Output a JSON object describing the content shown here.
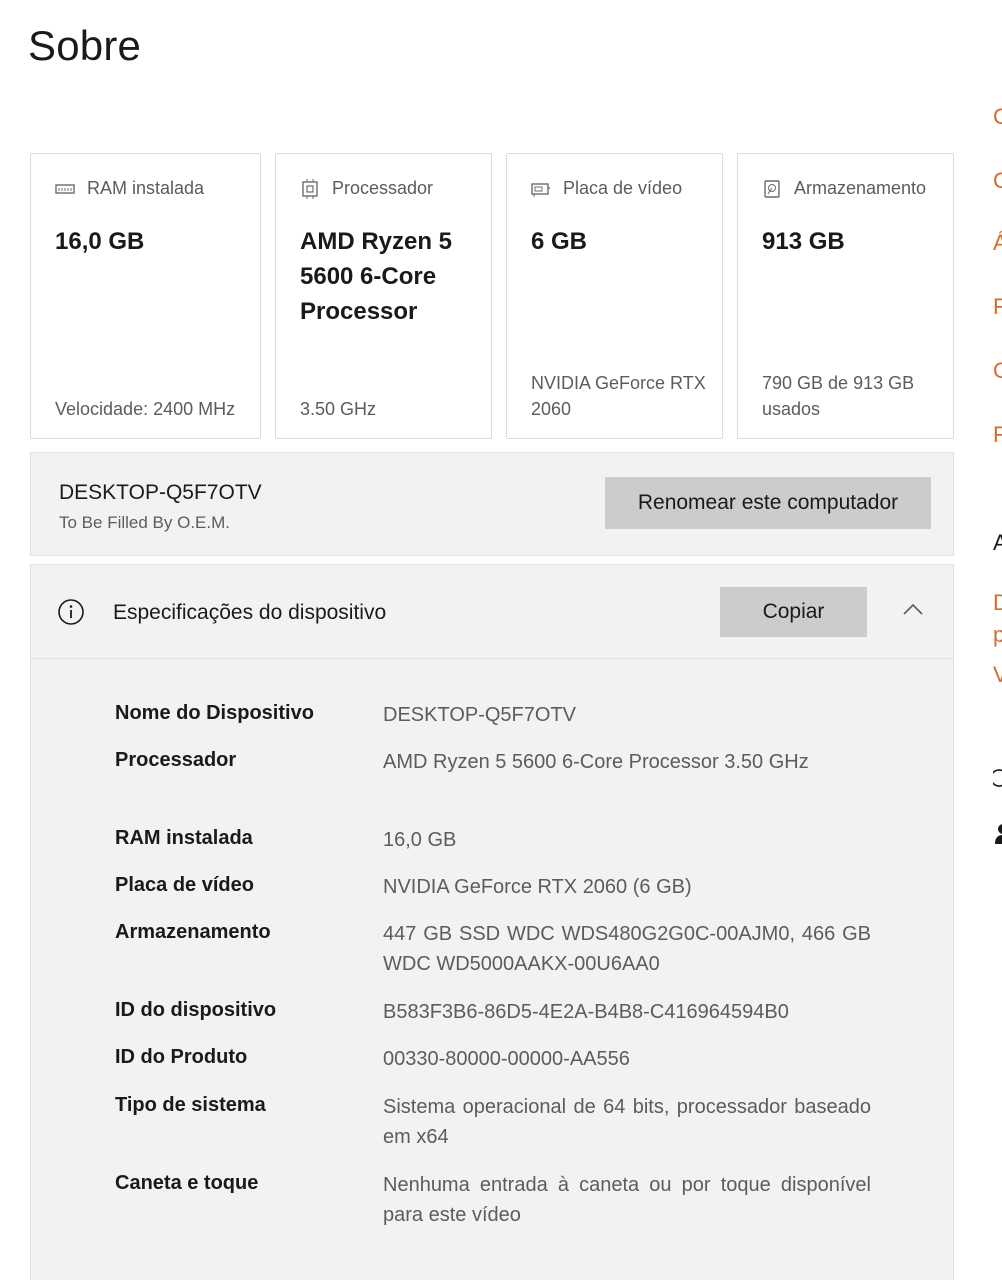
{
  "page_title": "Sobre",
  "cards": [
    {
      "label": "RAM instalada",
      "value": "16,0 GB",
      "footer": "Velocidade: 2400 MHz",
      "icon": "memory-icon"
    },
    {
      "label": "Processador",
      "value": "AMD Ryzen 5 5600 6-Core Processor",
      "footer": "3.50 GHz",
      "icon": "cpu-icon"
    },
    {
      "label": "Placa de vídeo",
      "value": "6 GB",
      "footer": "NVIDIA GeForce RTX 2060",
      "icon": "gpu-icon"
    },
    {
      "label": "Armazenamento",
      "value": "913 GB",
      "footer": "790 GB de 913 GB usados",
      "icon": "storage-icon"
    }
  ],
  "device": {
    "name": "DESKTOP-Q5F7OTV",
    "oem": "To Be Filled By O.E.M.",
    "rename_label": "Renomear este computador"
  },
  "specs": {
    "title": "Especificações do dispositivo",
    "copy_label": "Copiar",
    "rows": [
      {
        "label": "Nome do Dispositivo",
        "value": "DESKTOP-Q5F7OTV"
      },
      {
        "label": "Processador",
        "value": "AMD Ryzen 5 5600 6-Core Processor 3.50 GHz"
      },
      {
        "label": "RAM instalada",
        "value": "16,0 GB"
      },
      {
        "label": "Placa de vídeo",
        "value": "NVIDIA GeForce RTX 2060 (6 GB)"
      },
      {
        "label": "Armazenamento",
        "value": "447 GB SSD WDC WDS480G2G0C-00AJM0, 466 GB WDC WD5000AAKX-00U6AA0"
      },
      {
        "label": "ID do dispositivo",
        "value": "B583F3B6-86D5-4E2A-B4B8-C416964594B0"
      },
      {
        "label": "ID do Produto",
        "value": "00330-80000-00000-AA556"
      },
      {
        "label": "Tipo de sistema",
        "value": "Sistema operacional de 64 bits, processador baseado em x64"
      },
      {
        "label": "Caneta e toque",
        "value": "Nenhuma entrada à caneta ou por toque disponível para este vídeo"
      }
    ]
  },
  "edge_glyphs": [
    "C",
    "C",
    "Á",
    "F",
    "C",
    "F",
    "A",
    "D",
    "p",
    "V"
  ],
  "colors": {
    "accent": "#d86b2c",
    "panel_bg": "#f2f2f2",
    "button_bg": "#cccccc"
  }
}
